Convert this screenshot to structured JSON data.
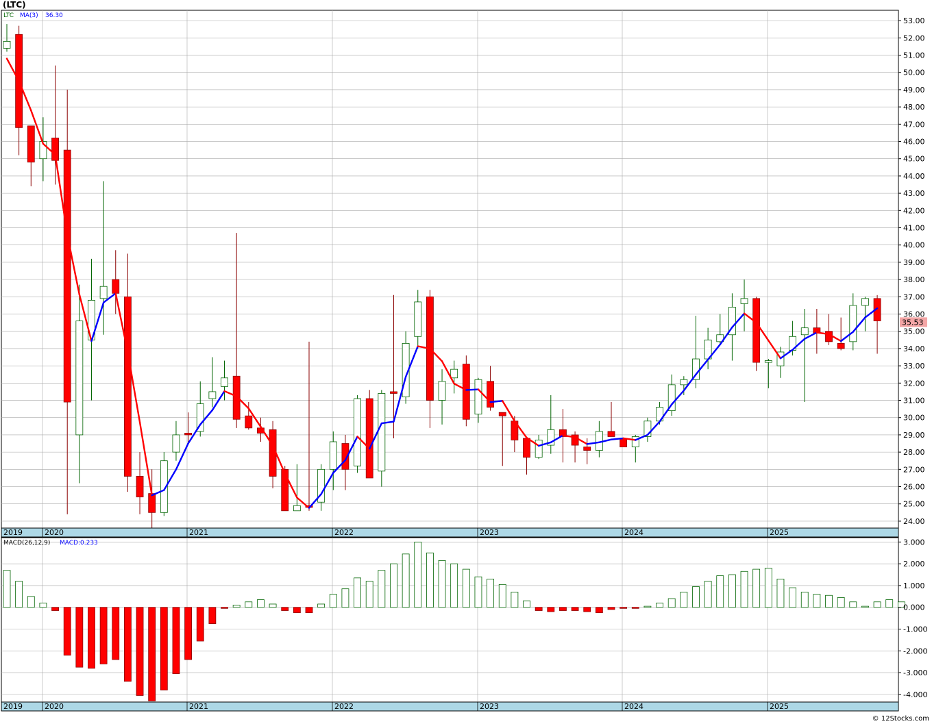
{
  "title": "(LTC)",
  "copyright": "© 12Stocks.com",
  "colors": {
    "up_fill": "#ffffff",
    "up_stroke": "#006400",
    "down_fill": "#ff0000",
    "down_stroke": "#8b0000",
    "ma_up": "#0000ff",
    "ma_down": "#ff0000",
    "time_axis": "#add8e6",
    "grid": "#a9a9a9",
    "last_price_bg": "#f4a6a6"
  },
  "chart_data": [
    {
      "type": "candlestick",
      "ticker_label": "LTC",
      "indicator_label": "MA(3)",
      "indicator_value": "36.30",
      "last_price": "35.53",
      "ylim": [
        23.6,
        53.6
      ],
      "y_ticks": [
        "24.00",
        "25.00",
        "26.00",
        "27.00",
        "28.00",
        "29.00",
        "30.00",
        "31.00",
        "32.00",
        "33.00",
        "34.00",
        "35.00",
        "36.00",
        "37.00",
        "38.00",
        "39.00",
        "40.00",
        "41.00",
        "42.00",
        "43.00",
        "44.00",
        "45.00",
        "46.00",
        "47.00",
        "48.00",
        "49.00",
        "50.00",
        "51.00",
        "52.00",
        "53.00"
      ],
      "x_labels": [
        "2019",
        "2020",
        "2021",
        "2022",
        "2023",
        "2024",
        "2025"
      ],
      "grid": true,
      "candles": [
        {
          "o": 51.4,
          "h": 52.8,
          "l": 51.2,
          "c": 51.8
        },
        {
          "o": 52.2,
          "h": 52.7,
          "l": 45.2,
          "c": 46.8
        },
        {
          "o": 46.9,
          "h": 46.9,
          "l": 43.4,
          "c": 44.8
        },
        {
          "o": 45.0,
          "h": 47.4,
          "l": 43.7,
          "c": 46.0
        },
        {
          "o": 46.2,
          "h": 50.4,
          "l": 43.5,
          "c": 44.9
        },
        {
          "o": 45.5,
          "h": 49.0,
          "l": 24.4,
          "c": 30.9
        },
        {
          "o": 29.0,
          "h": 37.7,
          "l": 26.2,
          "c": 35.6
        },
        {
          "o": 34.5,
          "h": 39.2,
          "l": 31.0,
          "c": 36.8
        },
        {
          "o": 36.9,
          "h": 43.7,
          "l": 34.8,
          "c": 37.6
        },
        {
          "o": 38.0,
          "h": 39.7,
          "l": 36.0,
          "c": 37.2
        },
        {
          "o": 37.0,
          "h": 39.5,
          "l": 25.7,
          "c": 26.6
        },
        {
          "o": 26.6,
          "h": 28.0,
          "l": 24.4,
          "c": 25.4
        },
        {
          "o": 25.6,
          "h": 27.0,
          "l": 23.6,
          "c": 24.5
        },
        {
          "o": 24.5,
          "h": 28.0,
          "l": 24.3,
          "c": 27.5
        },
        {
          "o": 28.0,
          "h": 29.8,
          "l": 27.5,
          "c": 29.0
        },
        {
          "o": 29.1,
          "h": 30.3,
          "l": 28.6,
          "c": 29.0
        },
        {
          "o": 29.2,
          "h": 32.1,
          "l": 28.9,
          "c": 30.8
        },
        {
          "o": 31.1,
          "h": 33.5,
          "l": 30.6,
          "c": 31.5
        },
        {
          "o": 31.8,
          "h": 33.3,
          "l": 31.0,
          "c": 32.3
        },
        {
          "o": 32.4,
          "h": 40.7,
          "l": 29.4,
          "c": 29.9
        },
        {
          "o": 30.1,
          "h": 30.9,
          "l": 29.3,
          "c": 29.4
        },
        {
          "o": 29.4,
          "h": 30.0,
          "l": 28.6,
          "c": 29.1
        },
        {
          "o": 29.3,
          "h": 29.8,
          "l": 25.9,
          "c": 26.6
        },
        {
          "o": 27.0,
          "h": 27.2,
          "l": 24.6,
          "c": 24.6
        },
        {
          "o": 24.6,
          "h": 27.3,
          "l": 24.6,
          "c": 24.9
        },
        {
          "o": 24.9,
          "h": 34.4,
          "l": 24.6,
          "c": 24.8
        },
        {
          "o": 25.1,
          "h": 27.3,
          "l": 24.6,
          "c": 27.0
        },
        {
          "o": 27.0,
          "h": 29.2,
          "l": 25.8,
          "c": 28.6
        },
        {
          "o": 28.5,
          "h": 29.0,
          "l": 25.8,
          "c": 27.0
        },
        {
          "o": 27.2,
          "h": 31.3,
          "l": 26.8,
          "c": 31.1
        },
        {
          "o": 31.1,
          "h": 31.6,
          "l": 26.5,
          "c": 26.5
        },
        {
          "o": 26.9,
          "h": 31.6,
          "l": 26.0,
          "c": 31.4
        },
        {
          "o": 31.5,
          "h": 37.1,
          "l": 28.8,
          "c": 31.4
        },
        {
          "o": 31.2,
          "h": 35.0,
          "l": 30.8,
          "c": 34.3
        },
        {
          "o": 34.7,
          "h": 37.4,
          "l": 34.0,
          "c": 36.7
        },
        {
          "o": 37.0,
          "h": 37.4,
          "l": 29.4,
          "c": 31.0
        },
        {
          "o": 31.0,
          "h": 32.8,
          "l": 29.6,
          "c": 32.1
        },
        {
          "o": 32.3,
          "h": 33.3,
          "l": 31.4,
          "c": 32.8
        },
        {
          "o": 33.1,
          "h": 33.6,
          "l": 29.5,
          "c": 29.9
        },
        {
          "o": 30.2,
          "h": 32.3,
          "l": 29.7,
          "c": 32.2
        },
        {
          "o": 32.1,
          "h": 33.0,
          "l": 30.4,
          "c": 30.6
        },
        {
          "o": 30.3,
          "h": 30.3,
          "l": 27.2,
          "c": 30.1
        },
        {
          "o": 29.8,
          "h": 30.1,
          "l": 28.0,
          "c": 28.7
        },
        {
          "o": 28.8,
          "h": 28.8,
          "l": 26.7,
          "c": 27.7
        },
        {
          "o": 27.7,
          "h": 29.0,
          "l": 27.6,
          "c": 28.7
        },
        {
          "o": 28.4,
          "h": 31.3,
          "l": 27.9,
          "c": 29.3
        },
        {
          "o": 29.3,
          "h": 30.5,
          "l": 27.4,
          "c": 28.9
        },
        {
          "o": 29.0,
          "h": 29.2,
          "l": 27.4,
          "c": 28.4
        },
        {
          "o": 28.3,
          "h": 28.8,
          "l": 27.3,
          "c": 28.1
        },
        {
          "o": 28.1,
          "h": 29.8,
          "l": 27.7,
          "c": 29.2
        },
        {
          "o": 29.2,
          "h": 30.9,
          "l": 28.9,
          "c": 28.9
        },
        {
          "o": 28.8,
          "h": 28.8,
          "l": 28.4,
          "c": 28.3
        },
        {
          "o": 28.3,
          "h": 29.0,
          "l": 27.4,
          "c": 28.9
        },
        {
          "o": 28.9,
          "h": 30.0,
          "l": 28.6,
          "c": 29.8
        },
        {
          "o": 29.8,
          "h": 30.9,
          "l": 29.6,
          "c": 30.6
        },
        {
          "o": 30.4,
          "h": 32.5,
          "l": 30.1,
          "c": 31.9
        },
        {
          "o": 31.9,
          "h": 32.4,
          "l": 31.3,
          "c": 32.2
        },
        {
          "o": 32.2,
          "h": 35.9,
          "l": 31.7,
          "c": 33.4
        },
        {
          "o": 33.4,
          "h": 35.2,
          "l": 32.8,
          "c": 34.5
        },
        {
          "o": 34.4,
          "h": 36.0,
          "l": 34.3,
          "c": 34.8
        },
        {
          "o": 34.8,
          "h": 37.2,
          "l": 33.3,
          "c": 36.4
        },
        {
          "o": 36.6,
          "h": 38.0,
          "l": 35.0,
          "c": 36.9
        },
        {
          "o": 36.9,
          "h": 37.0,
          "l": 32.7,
          "c": 33.2
        },
        {
          "o": 33.2,
          "h": 33.4,
          "l": 31.7,
          "c": 33.3
        },
        {
          "o": 33.0,
          "h": 34.1,
          "l": 32.3,
          "c": 33.8
        },
        {
          "o": 33.9,
          "h": 35.6,
          "l": 33.6,
          "c": 34.7
        },
        {
          "o": 34.8,
          "h": 36.3,
          "l": 30.9,
          "c": 35.2
        },
        {
          "o": 35.2,
          "h": 36.3,
          "l": 33.7,
          "c": 34.9
        },
        {
          "o": 35.0,
          "h": 36.0,
          "l": 34.2,
          "c": 34.4
        },
        {
          "o": 34.3,
          "h": 35.8,
          "l": 33.9,
          "c": 34.0
        },
        {
          "o": 34.4,
          "h": 37.2,
          "l": 33.9,
          "c": 36.5
        },
        {
          "o": 36.5,
          "h": 37.0,
          "l": 35.0,
          "c": 36.9
        },
        {
          "o": 36.9,
          "h": 37.1,
          "l": 33.7,
          "c": 35.6
        }
      ]
    },
    {
      "type": "bar",
      "indicator_label": "MACD(26,12,9)",
      "indicator_value": "MACD:0.233",
      "ylim": [
        -4.35,
        3.2
      ],
      "y_ticks": [
        "-4.000",
        "-3.000",
        "-2.000",
        "-1.000",
        "0.000",
        "1.000",
        "2.000",
        "3.000"
      ],
      "x_labels": [
        "2019",
        "2020",
        "2021",
        "2022",
        "2023",
        "2024",
        "2025"
      ],
      "grid": true,
      "values": [
        1.7,
        1.2,
        0.5,
        0.2,
        -0.15,
        -2.2,
        -2.75,
        -2.8,
        -2.6,
        -2.4,
        -3.4,
        -4.05,
        -4.3,
        -3.8,
        -3.05,
        -2.4,
        -1.55,
        -0.75,
        -0.05,
        0.1,
        0.25,
        0.35,
        0.15,
        -0.15,
        -0.25,
        -0.25,
        0.15,
        0.6,
        0.85,
        1.35,
        1.2,
        1.7,
        2.0,
        2.45,
        3.0,
        2.5,
        2.15,
        2.0,
        1.75,
        1.4,
        1.3,
        1.05,
        0.7,
        0.3,
        -0.15,
        -0.2,
        -0.15,
        -0.15,
        -0.2,
        -0.25,
        -0.1,
        -0.05,
        -0.05,
        0.05,
        0.2,
        0.4,
        0.7,
        0.95,
        1.2,
        1.45,
        1.5,
        1.65,
        1.75,
        1.8,
        1.3,
        0.9,
        0.7,
        0.6,
        0.55,
        0.45,
        0.25,
        0.05,
        0.25,
        0.35,
        0.25
      ]
    }
  ]
}
